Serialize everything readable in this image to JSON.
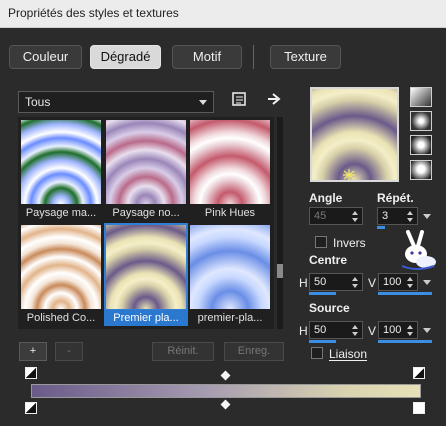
{
  "window": {
    "title": "Propriétés des styles et textures"
  },
  "tabs": [
    {
      "label": "Couleur",
      "active": false
    },
    {
      "label": "Dégradé",
      "active": true
    },
    {
      "label": "Motif",
      "active": false
    },
    {
      "label": "Texture",
      "active": false
    }
  ],
  "category_select": {
    "value": "Tous"
  },
  "toolbar_icons": [
    "gradient-editor-icon",
    "arrow-right-icon"
  ],
  "gradients": [
    {
      "name": "Paysage ma...",
      "selected": false
    },
    {
      "name": "Paysage no...",
      "selected": false
    },
    {
      "name": "Pink Hues",
      "selected": false
    },
    {
      "name": "Polished Co...",
      "selected": false
    },
    {
      "name": "Premier pla...",
      "selected": true
    },
    {
      "name": "premier-pla...",
      "selected": false
    }
  ],
  "gallery_buttons": {
    "add": "+",
    "remove": "-",
    "reset": "Réinit.",
    "save": "Enreg."
  },
  "style_buttons": [
    "linear-style-icon",
    "rectangular-style-icon",
    "sunburst-style-icon",
    "radial-style-icon"
  ],
  "angle": {
    "label": "Angle",
    "value": "45",
    "enabled": false
  },
  "repeat": {
    "label": "Répét.",
    "value": "3"
  },
  "invert": {
    "label": "Invers",
    "checked": false
  },
  "center": {
    "label": "Centre",
    "h_label": "H",
    "h_value": "50",
    "v_label": "V",
    "v_value": "100"
  },
  "source": {
    "label": "Source",
    "h_label": "H",
    "h_value": "50",
    "v_label": "V",
    "v_value": "100"
  },
  "link": {
    "label": "Liaison",
    "checked": false
  },
  "gradient_bar": {
    "colors": [
      "#6a5a8a",
      "#a69cb0",
      "#d8d2b0",
      "#e6e1b6"
    ]
  },
  "colors": {
    "accent": "#2b78cf",
    "panel_bg": "#2b2b2b"
  }
}
